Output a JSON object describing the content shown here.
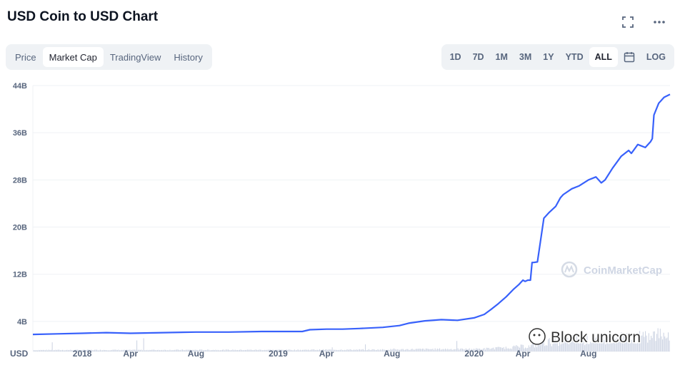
{
  "header": {
    "title": "USD Coin to USD Chart",
    "fullscreen_icon": "fullscreen-icon",
    "more_icon": "more-dots-icon"
  },
  "tabs": [
    {
      "label": "Price",
      "active": false
    },
    {
      "label": "Market Cap",
      "active": true
    },
    {
      "label": "TradingView",
      "active": false
    },
    {
      "label": "History",
      "active": false
    }
  ],
  "ranges": [
    {
      "label": "1D",
      "active": false
    },
    {
      "label": "7D",
      "active": false
    },
    {
      "label": "1M",
      "active": false
    },
    {
      "label": "3M",
      "active": false
    },
    {
      "label": "1Y",
      "active": false
    },
    {
      "label": "YTD",
      "active": false
    },
    {
      "label": "ALL",
      "active": true
    }
  ],
  "calendar_icon": "calendar-icon",
  "log_label": "LOG",
  "watermarks": {
    "cmc": "CoinMarketCap",
    "block": "Block unicorn"
  },
  "colors": {
    "line": "#3861fb",
    "volume": "#cfd6e4",
    "grid": "#eff2f5",
    "axis_text": "#58667e"
  },
  "chart_data": {
    "type": "line",
    "ylim": [
      0,
      44
    ],
    "y_ticks": [
      4,
      12,
      20,
      28,
      36,
      44
    ],
    "y_tick_labels": [
      "4B",
      "12B",
      "20B",
      "28B",
      "36B",
      "44B"
    ],
    "y_unit": "USD",
    "x_tick_labels": [
      {
        "label": "2018",
        "date": "2018-01-01"
      },
      {
        "label": "Apr",
        "date": "2018-04-01"
      },
      {
        "label": "Aug",
        "date": "2018-08-01"
      },
      {
        "label": "2019",
        "date": "2019-01-01"
      },
      {
        "label": "Apr",
        "date": "2019-04-01"
      },
      {
        "label": "Aug",
        "date": "2019-08-01"
      },
      {
        "label": "2020",
        "date": "2020-01-01"
      },
      {
        "label": "Apr",
        "date": "2020-04-01"
      },
      {
        "label": "Aug",
        "date": "2020-08-01"
      }
    ],
    "xlim": [
      "2017-10-01",
      "2020-12-31"
    ],
    "series": [
      {
        "dates": [
          "2017-10-01",
          "2017-11-15",
          "2018-01-01",
          "2018-02-15",
          "2018-04-01",
          "2018-06-01",
          "2018-08-01",
          "2018-10-01",
          "2018-12-01",
          "2019-01-01",
          "2019-02-15",
          "2019-03-01",
          "2019-04-01",
          "2019-05-01",
          "2019-06-01",
          "2019-07-15",
          "2019-08-15",
          "2019-09-01",
          "2019-10-01",
          "2019-11-01",
          "2019-12-01",
          "2020-01-01",
          "2020-01-20",
          "2020-02-01",
          "2020-02-15",
          "2020-03-01",
          "2020-03-15",
          "2020-03-25",
          "2020-04-01",
          "2020-04-05",
          "2020-04-10",
          "2020-04-15",
          "2020-04-18",
          "2020-04-20",
          "2020-04-21",
          "2020-04-28",
          "2020-05-10",
          "2020-05-20",
          "2020-06-01",
          "2020-06-10",
          "2020-06-15",
          "2020-07-01",
          "2020-07-15",
          "2020-08-01",
          "2020-08-15",
          "2020-08-25",
          "2020-09-01",
          "2020-09-15",
          "2020-10-01",
          "2020-10-15",
          "2020-10-20",
          "2020-11-01",
          "2020-11-15",
          "2020-11-25",
          "2020-11-28",
          "2020-12-01",
          "2020-12-10",
          "2020-12-20",
          "2020-12-31"
        ],
        "values": [
          1.8,
          1.9,
          2.0,
          2.1,
          2.0,
          2.1,
          2.2,
          2.2,
          2.3,
          2.3,
          2.3,
          2.6,
          2.7,
          2.7,
          2.8,
          3.0,
          3.3,
          3.7,
          4.1,
          4.3,
          4.2,
          4.6,
          5.2,
          6.0,
          7.0,
          8.2,
          9.5,
          10.3,
          11.0,
          10.8,
          11.0,
          11.0,
          14.0,
          14.0,
          14.0,
          14.1,
          21.5,
          22.5,
          23.5,
          25.0,
          25.5,
          26.5,
          27.0,
          28.0,
          28.5,
          27.5,
          28.0,
          30.0,
          32.0,
          33.0,
          32.5,
          34.0,
          33.5,
          34.5,
          35.0,
          39.0,
          41.0,
          42.0,
          42.5
        ]
      }
    ]
  }
}
